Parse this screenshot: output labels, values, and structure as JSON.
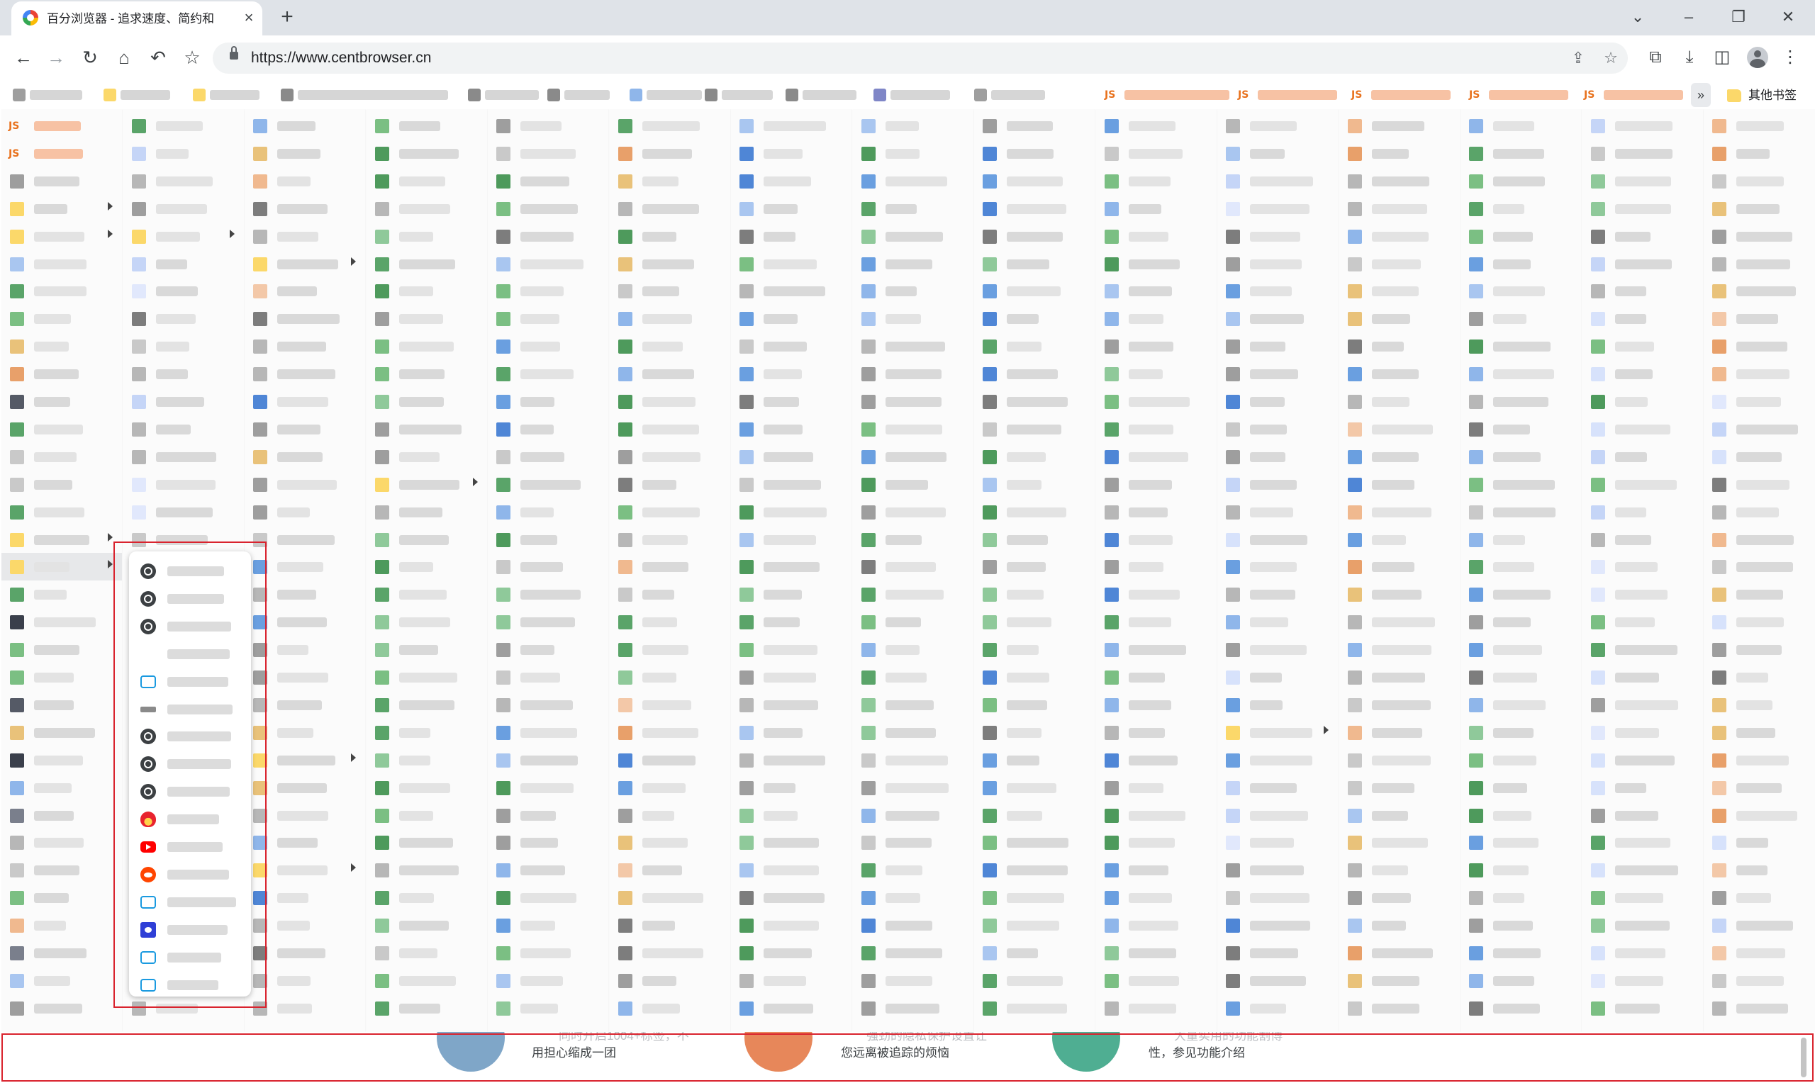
{
  "window": {
    "tab_title": "百分浏览器 - 追求速度、简约和",
    "tab_close": "×",
    "new_tab": "+",
    "controls": {
      "dropdown": "⌄",
      "minimize": "–",
      "restore": "❐",
      "close": "✕"
    }
  },
  "toolbar": {
    "back": "←",
    "forward": "→",
    "reload": "↻",
    "home": "⌂",
    "undo": "↶",
    "favorite": "☆",
    "url": "https://www.centbrowser.cn",
    "share": "⇪",
    "bookmark_star": "☆",
    "crop": "⧉",
    "download": "⤓",
    "side_panel": "◫",
    "menu": "⋮"
  },
  "bookmarks_bar": {
    "overflow": "»",
    "other_bookmarks": "其他书签",
    "js_label": "JS"
  },
  "page": {
    "features": [
      {
        "line1": "同时开启1004+标签，不",
        "line2": "用担心缩成一团"
      },
      {
        "line1": "强劲的隐私保护设置让",
        "line2": "您远离被追踪的烦恼"
      },
      {
        "line1": "大量实用的功能割傅",
        "line2": "性，参见功能介绍"
      }
    ]
  },
  "colors": {
    "accent_red": "#d9232e",
    "js_orange": "#e8711c",
    "folder_yellow": "#fbd86a"
  }
}
